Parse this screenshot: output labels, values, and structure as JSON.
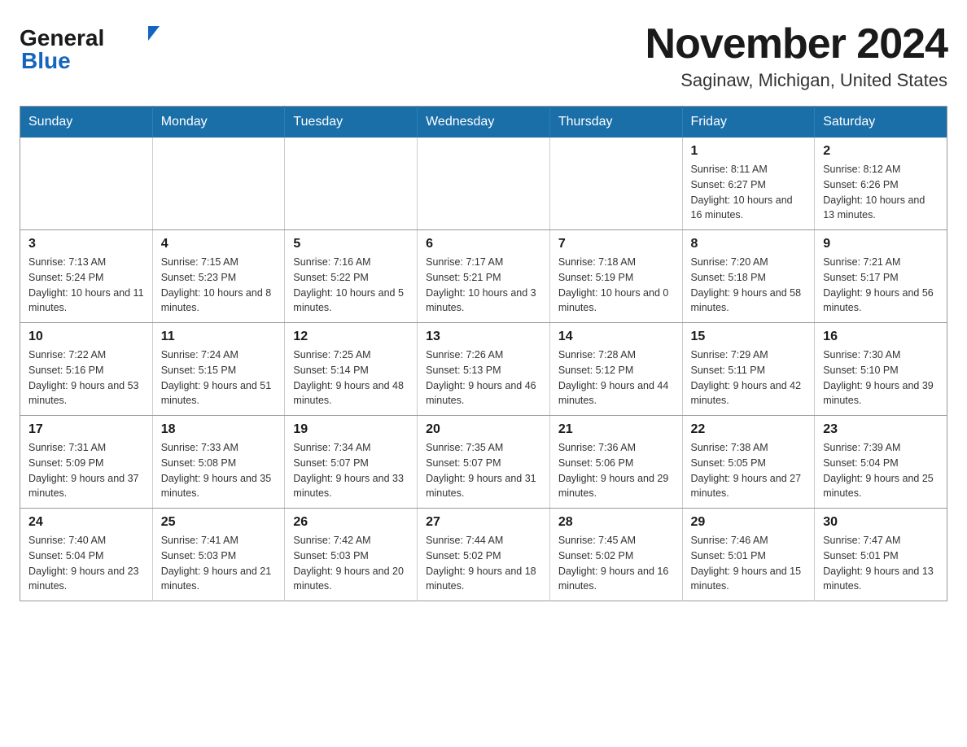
{
  "header": {
    "logo_general": "General",
    "logo_blue": "Blue",
    "month_title": "November 2024",
    "location": "Saginaw, Michigan, United States"
  },
  "weekdays": [
    "Sunday",
    "Monday",
    "Tuesday",
    "Wednesday",
    "Thursday",
    "Friday",
    "Saturday"
  ],
  "weeks": [
    [
      {
        "day": "",
        "info": ""
      },
      {
        "day": "",
        "info": ""
      },
      {
        "day": "",
        "info": ""
      },
      {
        "day": "",
        "info": ""
      },
      {
        "day": "",
        "info": ""
      },
      {
        "day": "1",
        "info": "Sunrise: 8:11 AM\nSunset: 6:27 PM\nDaylight: 10 hours and 16 minutes."
      },
      {
        "day": "2",
        "info": "Sunrise: 8:12 AM\nSunset: 6:26 PM\nDaylight: 10 hours and 13 minutes."
      }
    ],
    [
      {
        "day": "3",
        "info": "Sunrise: 7:13 AM\nSunset: 5:24 PM\nDaylight: 10 hours and 11 minutes."
      },
      {
        "day": "4",
        "info": "Sunrise: 7:15 AM\nSunset: 5:23 PM\nDaylight: 10 hours and 8 minutes."
      },
      {
        "day": "5",
        "info": "Sunrise: 7:16 AM\nSunset: 5:22 PM\nDaylight: 10 hours and 5 minutes."
      },
      {
        "day": "6",
        "info": "Sunrise: 7:17 AM\nSunset: 5:21 PM\nDaylight: 10 hours and 3 minutes."
      },
      {
        "day": "7",
        "info": "Sunrise: 7:18 AM\nSunset: 5:19 PM\nDaylight: 10 hours and 0 minutes."
      },
      {
        "day": "8",
        "info": "Sunrise: 7:20 AM\nSunset: 5:18 PM\nDaylight: 9 hours and 58 minutes."
      },
      {
        "day": "9",
        "info": "Sunrise: 7:21 AM\nSunset: 5:17 PM\nDaylight: 9 hours and 56 minutes."
      }
    ],
    [
      {
        "day": "10",
        "info": "Sunrise: 7:22 AM\nSunset: 5:16 PM\nDaylight: 9 hours and 53 minutes."
      },
      {
        "day": "11",
        "info": "Sunrise: 7:24 AM\nSunset: 5:15 PM\nDaylight: 9 hours and 51 minutes."
      },
      {
        "day": "12",
        "info": "Sunrise: 7:25 AM\nSunset: 5:14 PM\nDaylight: 9 hours and 48 minutes."
      },
      {
        "day": "13",
        "info": "Sunrise: 7:26 AM\nSunset: 5:13 PM\nDaylight: 9 hours and 46 minutes."
      },
      {
        "day": "14",
        "info": "Sunrise: 7:28 AM\nSunset: 5:12 PM\nDaylight: 9 hours and 44 minutes."
      },
      {
        "day": "15",
        "info": "Sunrise: 7:29 AM\nSunset: 5:11 PM\nDaylight: 9 hours and 42 minutes."
      },
      {
        "day": "16",
        "info": "Sunrise: 7:30 AM\nSunset: 5:10 PM\nDaylight: 9 hours and 39 minutes."
      }
    ],
    [
      {
        "day": "17",
        "info": "Sunrise: 7:31 AM\nSunset: 5:09 PM\nDaylight: 9 hours and 37 minutes."
      },
      {
        "day": "18",
        "info": "Sunrise: 7:33 AM\nSunset: 5:08 PM\nDaylight: 9 hours and 35 minutes."
      },
      {
        "day": "19",
        "info": "Sunrise: 7:34 AM\nSunset: 5:07 PM\nDaylight: 9 hours and 33 minutes."
      },
      {
        "day": "20",
        "info": "Sunrise: 7:35 AM\nSunset: 5:07 PM\nDaylight: 9 hours and 31 minutes."
      },
      {
        "day": "21",
        "info": "Sunrise: 7:36 AM\nSunset: 5:06 PM\nDaylight: 9 hours and 29 minutes."
      },
      {
        "day": "22",
        "info": "Sunrise: 7:38 AM\nSunset: 5:05 PM\nDaylight: 9 hours and 27 minutes."
      },
      {
        "day": "23",
        "info": "Sunrise: 7:39 AM\nSunset: 5:04 PM\nDaylight: 9 hours and 25 minutes."
      }
    ],
    [
      {
        "day": "24",
        "info": "Sunrise: 7:40 AM\nSunset: 5:04 PM\nDaylight: 9 hours and 23 minutes."
      },
      {
        "day": "25",
        "info": "Sunrise: 7:41 AM\nSunset: 5:03 PM\nDaylight: 9 hours and 21 minutes."
      },
      {
        "day": "26",
        "info": "Sunrise: 7:42 AM\nSunset: 5:03 PM\nDaylight: 9 hours and 20 minutes."
      },
      {
        "day": "27",
        "info": "Sunrise: 7:44 AM\nSunset: 5:02 PM\nDaylight: 9 hours and 18 minutes."
      },
      {
        "day": "28",
        "info": "Sunrise: 7:45 AM\nSunset: 5:02 PM\nDaylight: 9 hours and 16 minutes."
      },
      {
        "day": "29",
        "info": "Sunrise: 7:46 AM\nSunset: 5:01 PM\nDaylight: 9 hours and 15 minutes."
      },
      {
        "day": "30",
        "info": "Sunrise: 7:47 AM\nSunset: 5:01 PM\nDaylight: 9 hours and 13 minutes."
      }
    ]
  ]
}
